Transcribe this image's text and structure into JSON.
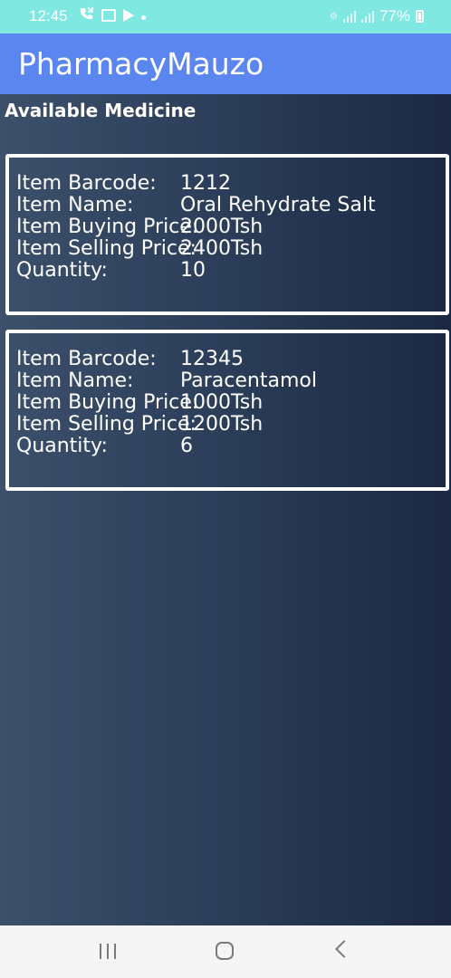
{
  "status_bar": {
    "time": "12:45",
    "battery": "77%",
    "icons": [
      "call-forward-icon",
      "image-icon",
      "play-icon",
      "dot-icon",
      "wifi-calling-icon",
      "signal-icon",
      "signal-icon",
      "battery-icon"
    ]
  },
  "app_bar": {
    "title": "PharmacyMauzo"
  },
  "main": {
    "section_title": "Available Medicine",
    "labels": {
      "barcode": "Item Barcode:",
      "name": "Item Name:",
      "buying": "Item Buying Price:",
      "selling": "Item Selling Price:",
      "quantity": "Quantity:"
    },
    "items": [
      {
        "barcode": "1212",
        "name": "Oral Rehydrate Salt",
        "buying": "2000Tsh",
        "selling": "2400Tsh",
        "quantity": "10"
      },
      {
        "barcode": "12345",
        "name": "Paracentamol",
        "buying": "1000Tsh",
        "selling": "1200Tsh",
        "quantity": "6"
      }
    ]
  },
  "nav_bar": {
    "icons": [
      "recent-apps-icon",
      "home-icon",
      "back-icon"
    ]
  },
  "colors": {
    "status_bar": "#7fe8e0",
    "app_bar": "#5b86ef",
    "background": "#24344e",
    "card_border": "#ffffff"
  }
}
